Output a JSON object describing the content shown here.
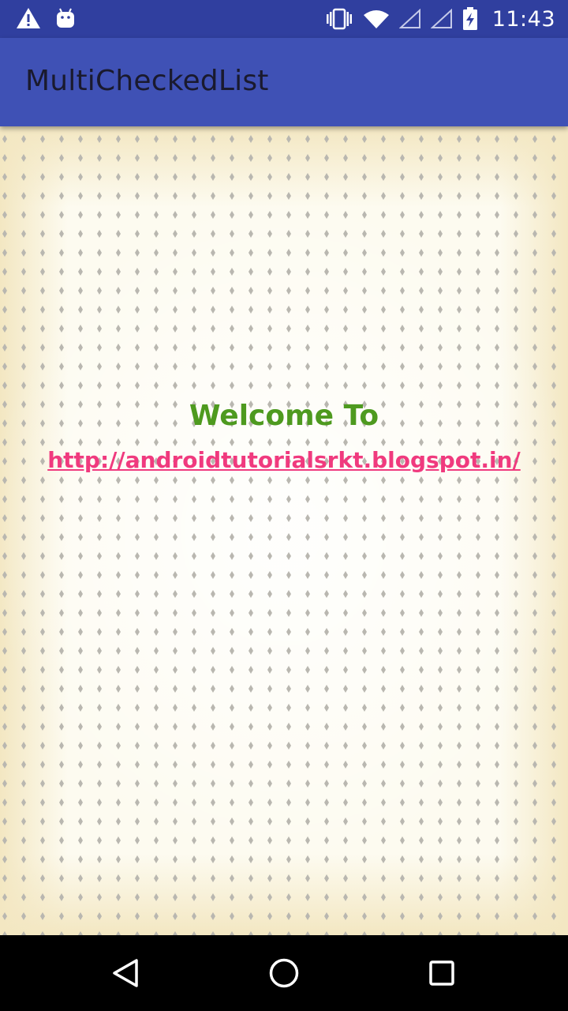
{
  "status_bar": {
    "time": "11:43",
    "icons_left": [
      "warning-icon",
      "android-icon"
    ],
    "icons_right": [
      "vibrate-icon",
      "wifi-icon",
      "signal-icon",
      "signal-icon",
      "battery-charging-icon"
    ]
  },
  "app_bar": {
    "title": "MultiCheckedList",
    "color": "#3f51b5"
  },
  "main": {
    "welcome_text": "Welcome To",
    "welcome_color": "#4e9a1f",
    "link_text": "http://androidtutorialsrkt.blogspot.in/",
    "link_color": "#f03a7e"
  },
  "nav_bar": {
    "buttons": [
      "back-icon",
      "home-icon",
      "recents-icon"
    ]
  }
}
